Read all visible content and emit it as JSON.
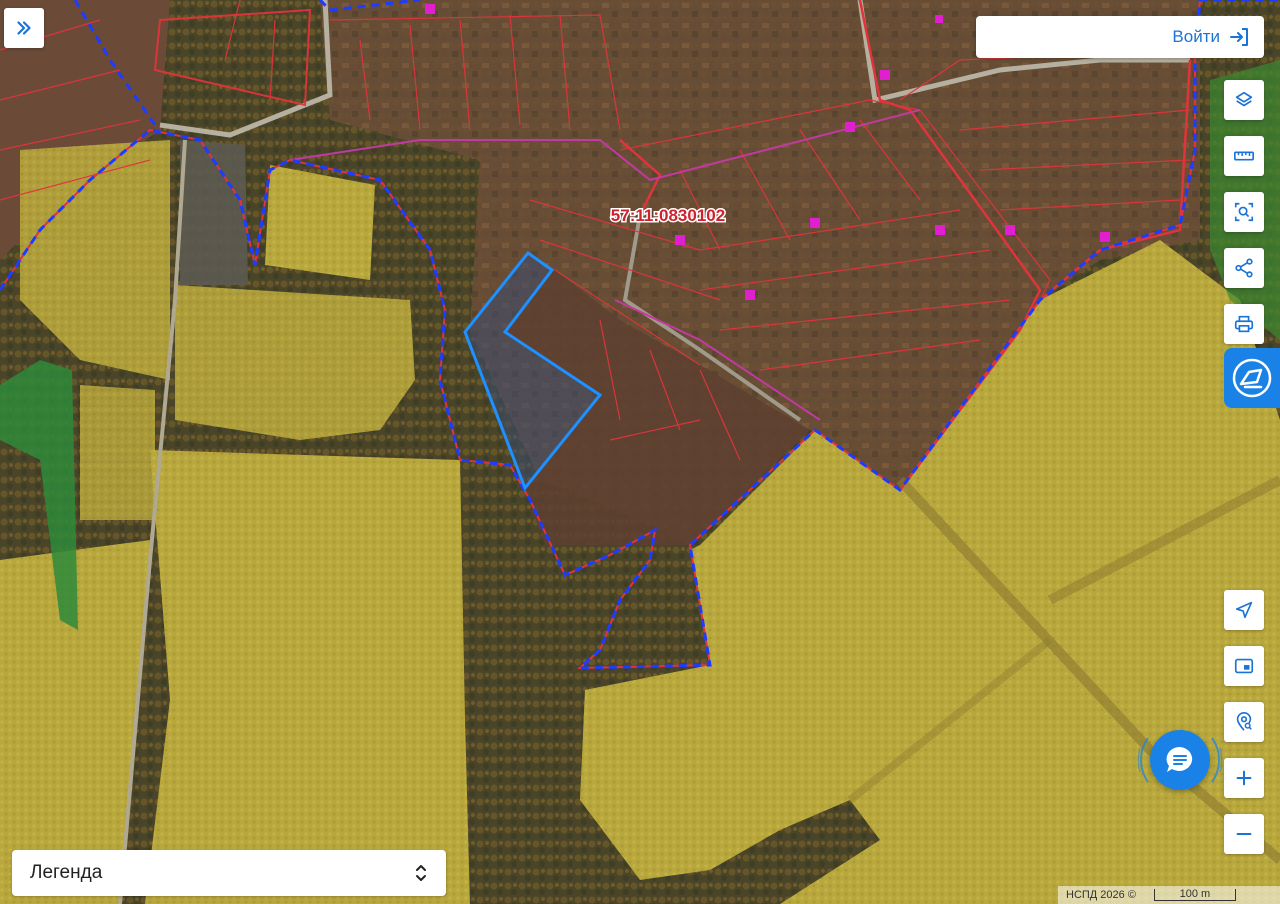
{
  "parcel": {
    "label": "57:11:0830102"
  },
  "auth": {
    "login_label": "Войти"
  },
  "toolbar": {
    "items": [
      {
        "name": "layers",
        "icon": "layers-icon"
      },
      {
        "name": "measure",
        "icon": "ruler-icon"
      },
      {
        "name": "area-search",
        "icon": "select-area-icon"
      },
      {
        "name": "share",
        "icon": "share-icon"
      },
      {
        "name": "print",
        "icon": "print-icon"
      }
    ]
  },
  "map_controls": {
    "items": [
      {
        "name": "locate",
        "icon": "navigation-icon"
      },
      {
        "name": "minimap",
        "icon": "minimap-icon"
      },
      {
        "name": "geo-search",
        "icon": "geo-search-icon"
      },
      {
        "name": "zoom-in",
        "icon": "plus-icon"
      },
      {
        "name": "zoom-out",
        "icon": "minus-icon"
      }
    ]
  },
  "legend": {
    "label": "Легенда"
  },
  "attribution": {
    "text": "НСПД 2026 ©",
    "scale_label": "100 m"
  },
  "colors": {
    "accent": "#1a82e6",
    "boundary_red": "#e0343c",
    "boundary_blue": "#1e3cff",
    "selected_parcel": "#1e90ff",
    "label_red": "#d0222c"
  }
}
